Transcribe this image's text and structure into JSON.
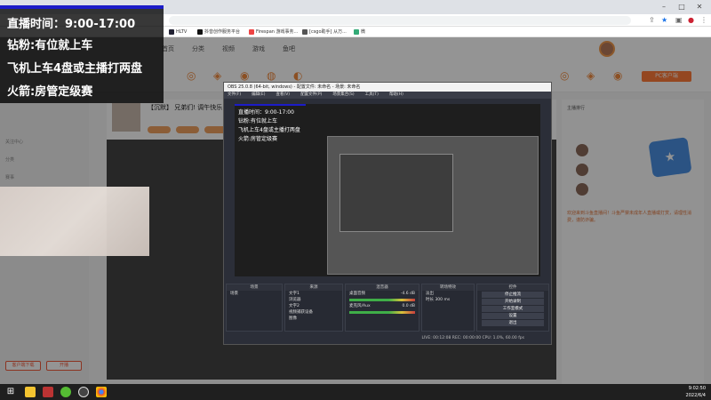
{
  "overlay": {
    "line1": "直播时间：9:00-17:00",
    "line2": "钻粉:有位就上车",
    "line3": "飞机上车4盘或主播打两盘",
    "line4": "火箭:房管定级赛"
  },
  "bookmarks": [
    "HLTV",
    "抖音创作服务平台",
    "Firespan 游戏事务...",
    "[csgo助手] 从万...",
    "微"
  ],
  "site": {
    "nav_tabs": [
      "首页",
      "分类",
      "视频",
      "游戏",
      "鱼吧"
    ],
    "pc_client": "PC客户端",
    "stream_title": "【沉默】 兄弟们! 调午快乐",
    "left_nav": [
      "关注中心",
      "分类",
      "赛事"
    ],
    "left_buttons": [
      "客户端下载",
      "开播"
    ],
    "right_title": "主播排行",
    "chat_notice": "欢迎来到斗鱼直播间！斗鱼严禁未成年人直播或打赏，请理性消费，谨防诈骗。"
  },
  "obs": {
    "title": "OBS 25.0.8 (64-bit, windows) - 配置文件: 未命名 - 场景: 未命名",
    "menu": [
      "文件(F)",
      "编辑(E)",
      "查看(V)",
      "配置文件(P)",
      "场景集合(S)",
      "工具(T)",
      "帮助(H)"
    ],
    "docks": {
      "scenes": "场景",
      "sources": "来源",
      "mixer": "混音器",
      "transitions": "转场特效",
      "controls": "控件"
    },
    "scene_items": [
      "场景"
    ],
    "source_items": [
      "文字1",
      "浏览器",
      "文字2",
      "视频捕获设备",
      "图像"
    ],
    "mixer_items": [
      "桌面音频",
      "麦克风/Aux"
    ],
    "mixer_levels": [
      "-4.6 dB",
      "0.0 dB"
    ],
    "transition": "淡出",
    "duration_label": "时长",
    "duration": "300 ms",
    "controls": [
      "停止推流",
      "开始录制",
      "工作室模式",
      "设置",
      "退出"
    ],
    "status": "LIVE: 00:12:08    REC: 00:00:00    CPU: 1.0%, 60.00 fps"
  },
  "clock": {
    "time": "9:02:50",
    "date": "2022/6/4"
  }
}
